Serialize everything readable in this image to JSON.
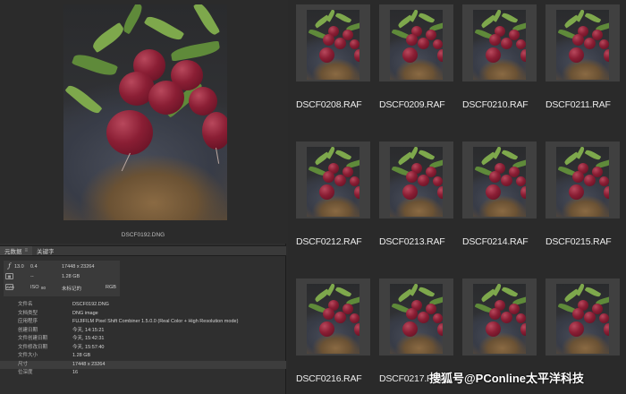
{
  "preview": {
    "filename": "DSCF0192.DNG"
  },
  "panel": {
    "tabs": [
      {
        "label": "元数据"
      },
      {
        "label": "关键字"
      }
    ],
    "tab_menu_icon": "≡"
  },
  "summary": {
    "aperture": "13.0",
    "shutter": "0.4",
    "dimensions": "17448 x 23264",
    "exposure_comp": "--",
    "size": "1.28 GB",
    "iso_label": "ISO",
    "iso": "80",
    "color_tag": "未标记的",
    "color_mode": "RGB"
  },
  "metadata": [
    {
      "label": "文件名",
      "value": "DSCF0192.DNG"
    },
    {
      "label": "文档类型",
      "value": "DNG image"
    },
    {
      "label": "应用程序",
      "value": "FUJIFILM Pixel Shift Combiner 1.5.0.0 (Real Color + High Resolution mode)"
    },
    {
      "label": "创建日期",
      "value": "今天, 14:15:21"
    },
    {
      "label": "文件创建日期",
      "value": "今天, 15:42:31"
    },
    {
      "label": "文件修改日期",
      "value": "今天, 15:57:40"
    },
    {
      "label": "文件大小",
      "value": "1.28 GB"
    },
    {
      "label": "尺寸",
      "value": "17448 x 23264"
    },
    {
      "label": "位深度",
      "value": "16"
    }
  ],
  "grid": {
    "items": [
      {
        "name": "DSCF0208.RAF"
      },
      {
        "name": "DSCF0209.RAF"
      },
      {
        "name": "DSCF0210.RAF"
      },
      {
        "name": "DSCF0211.RAF"
      },
      {
        "name": "DSCF0212.RAF"
      },
      {
        "name": "DSCF0213.RAF"
      },
      {
        "name": "DSCF0214.RAF"
      },
      {
        "name": "DSCF0215.RAF"
      },
      {
        "name": "DSCF0216.RAF"
      },
      {
        "name": "DSCF0217.RAF"
      },
      {
        "name": ""
      },
      {
        "name": ""
      }
    ]
  },
  "watermark": {
    "text": "搜狐号@PConline太平洋科技"
  }
}
